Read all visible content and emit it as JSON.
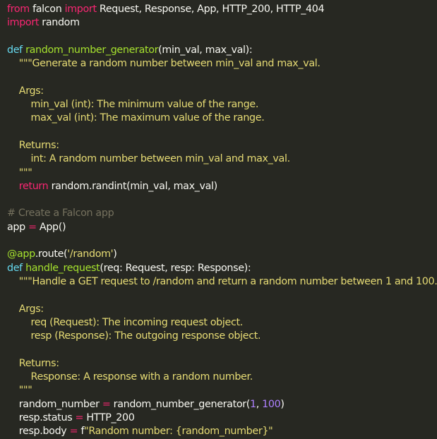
{
  "editor": {
    "theme_colors": {
      "background": "#272822",
      "foreground": "#f8f8f2",
      "keyword": "#f92672",
      "storage": "#66d9ef",
      "function": "#a6e22e",
      "string": "#e6db74",
      "comment": "#75715e",
      "number": "#ae81ff"
    },
    "lines": [
      {
        "tokens": [
          {
            "t": "kw",
            "v": "from"
          },
          {
            "t": "plain",
            "v": " falcon "
          },
          {
            "t": "kw",
            "v": "import"
          },
          {
            "t": "plain",
            "v": " Request, Response, App, HTTP_200, HTTP_404"
          }
        ]
      },
      {
        "tokens": [
          {
            "t": "kw",
            "v": "import"
          },
          {
            "t": "plain",
            "v": " random"
          }
        ]
      },
      {
        "tokens": []
      },
      {
        "tokens": [
          {
            "t": "def",
            "v": "def"
          },
          {
            "t": "plain",
            "v": " "
          },
          {
            "t": "fn",
            "v": "random_number_generator"
          },
          {
            "t": "plain",
            "v": "(min_val, max_val):"
          }
        ]
      },
      {
        "tokens": [
          {
            "t": "str",
            "v": "    \"\"\"Generate a random number between min_val and max_val."
          }
        ]
      },
      {
        "tokens": []
      },
      {
        "tokens": [
          {
            "t": "str",
            "v": "    Args:"
          }
        ]
      },
      {
        "tokens": [
          {
            "t": "str",
            "v": "        min_val (int): The minimum value of the range."
          }
        ]
      },
      {
        "tokens": [
          {
            "t": "str",
            "v": "        max_val (int): The maximum value of the range."
          }
        ]
      },
      {
        "tokens": []
      },
      {
        "tokens": [
          {
            "t": "str",
            "v": "    Returns:"
          }
        ]
      },
      {
        "tokens": [
          {
            "t": "str",
            "v": "        int: A random number between min_val and max_val."
          }
        ]
      },
      {
        "tokens": [
          {
            "t": "str",
            "v": "    \"\"\""
          }
        ]
      },
      {
        "tokens": [
          {
            "t": "plain",
            "v": "    "
          },
          {
            "t": "kw",
            "v": "return"
          },
          {
            "t": "plain",
            "v": " random.randint(min_val, max_val)"
          }
        ]
      },
      {
        "tokens": []
      },
      {
        "tokens": [
          {
            "t": "cm",
            "v": "# Create a Falcon app"
          }
        ]
      },
      {
        "tokens": [
          {
            "t": "plain",
            "v": "app "
          },
          {
            "t": "op",
            "v": "="
          },
          {
            "t": "plain",
            "v": " App()"
          }
        ]
      },
      {
        "tokens": []
      },
      {
        "tokens": [
          {
            "t": "fn",
            "v": "@app"
          },
          {
            "t": "plain",
            "v": ".route("
          },
          {
            "t": "str",
            "v": "'/random'"
          },
          {
            "t": "plain",
            "v": ")"
          }
        ]
      },
      {
        "tokens": [
          {
            "t": "def",
            "v": "def"
          },
          {
            "t": "plain",
            "v": " "
          },
          {
            "t": "fn",
            "v": "handle_request"
          },
          {
            "t": "plain",
            "v": "(req: Request, resp: Response):"
          }
        ]
      },
      {
        "tokens": [
          {
            "t": "str",
            "v": "    \"\"\"Handle a GET request to /random and return a random number between 1 and 100."
          }
        ]
      },
      {
        "tokens": []
      },
      {
        "tokens": [
          {
            "t": "str",
            "v": "    Args:"
          }
        ]
      },
      {
        "tokens": [
          {
            "t": "str",
            "v": "        req (Request): The incoming request object."
          }
        ]
      },
      {
        "tokens": [
          {
            "t": "str",
            "v": "        resp (Response): The outgoing response object."
          }
        ]
      },
      {
        "tokens": []
      },
      {
        "tokens": [
          {
            "t": "str",
            "v": "    Returns:"
          }
        ]
      },
      {
        "tokens": [
          {
            "t": "str",
            "v": "        Response: A response with a random number."
          }
        ]
      },
      {
        "tokens": [
          {
            "t": "str",
            "v": "    \"\"\""
          }
        ]
      },
      {
        "tokens": [
          {
            "t": "plain",
            "v": "    random_number "
          },
          {
            "t": "op",
            "v": "="
          },
          {
            "t": "plain",
            "v": " random_number_generator("
          },
          {
            "t": "num",
            "v": "1"
          },
          {
            "t": "plain",
            "v": ", "
          },
          {
            "t": "num",
            "v": "100"
          },
          {
            "t": "plain",
            "v": ")"
          }
        ]
      },
      {
        "tokens": [
          {
            "t": "plain",
            "v": "    resp.status "
          },
          {
            "t": "op",
            "v": "="
          },
          {
            "t": "plain",
            "v": " HTTP_200"
          }
        ]
      },
      {
        "tokens": [
          {
            "t": "plain",
            "v": "    resp.body "
          },
          {
            "t": "op",
            "v": "="
          },
          {
            "t": "plain",
            "v": " f"
          },
          {
            "t": "str",
            "v": "\"Random number: {random_number}\""
          }
        ]
      }
    ]
  }
}
